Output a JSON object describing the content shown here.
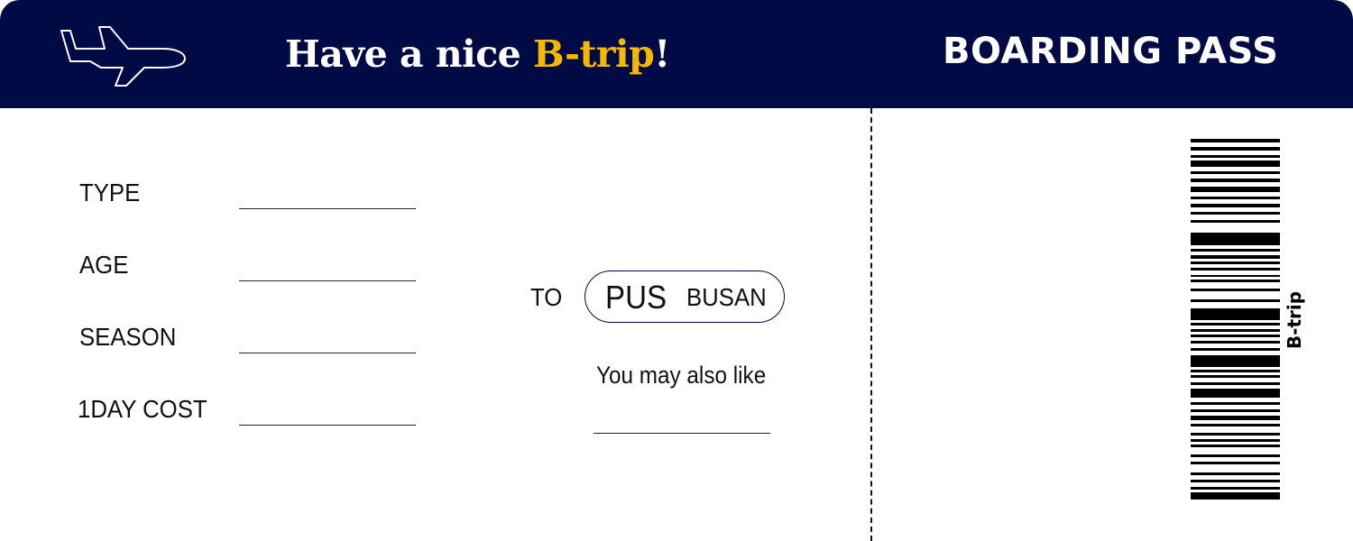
{
  "header": {
    "headline_prefix": "Have a nice ",
    "headline_brand": "B-trip",
    "headline_suffix": "!",
    "title": "BOARDING PASS"
  },
  "fields": [
    {
      "label": "TYPE"
    },
    {
      "label": "AGE"
    },
    {
      "label": "SEASON"
    },
    {
      "label": "1DAY COST"
    }
  ],
  "destination": {
    "to_label": "TO",
    "code": "PUS",
    "city": "BUSAN"
  },
  "recommendation": {
    "label": "You may also like"
  },
  "barcode": {
    "brand": "B-trip"
  },
  "colors": {
    "header_bg": "#000a45",
    "accent": "#f5b800",
    "text": "#111111"
  },
  "icons": [
    "airplane-icon",
    "barcode-icon"
  ]
}
